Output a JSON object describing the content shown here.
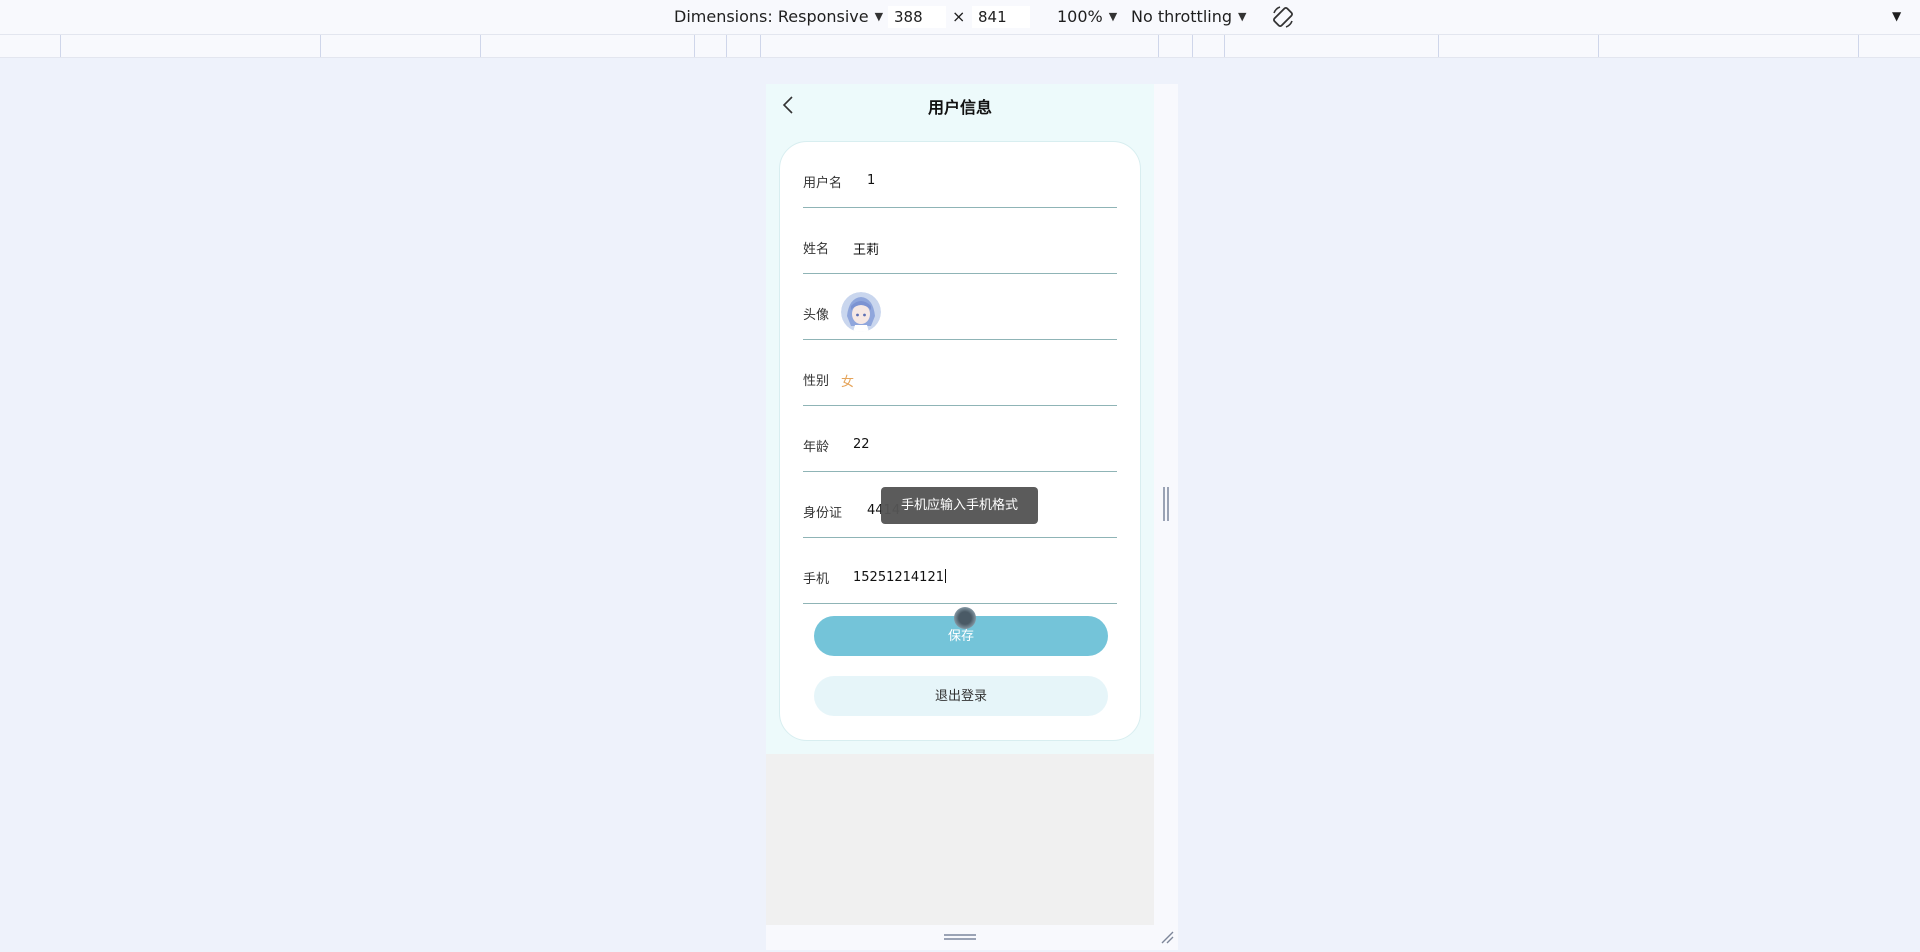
{
  "devtools": {
    "dimensions_label": "Dimensions: Responsive",
    "width": "388",
    "height": "841",
    "times": "×",
    "zoom": "100%",
    "throttling": "No throttling",
    "caret": "▼"
  },
  "app": {
    "title": "用户信息",
    "fields": [
      {
        "label": "用户名",
        "value": "1"
      },
      {
        "label": "姓名",
        "value": "王莉"
      },
      {
        "label": "头像",
        "value": ""
      },
      {
        "label": "性别",
        "value": "女"
      },
      {
        "label": "年龄",
        "value": "22"
      },
      {
        "label": "身份证",
        "value": "4414"
      },
      {
        "label": "手机",
        "value": "15251214121"
      }
    ],
    "toast": "手机应输入手机格式",
    "save_label": "保存",
    "logout_label": "退出登录"
  },
  "colors": {
    "page_bg": "#edfafb",
    "save_bg": "#74c4d9",
    "logout_bg": "#e6f5f9",
    "gender_color": "#e5a45a",
    "toast_bg": "#555555"
  }
}
